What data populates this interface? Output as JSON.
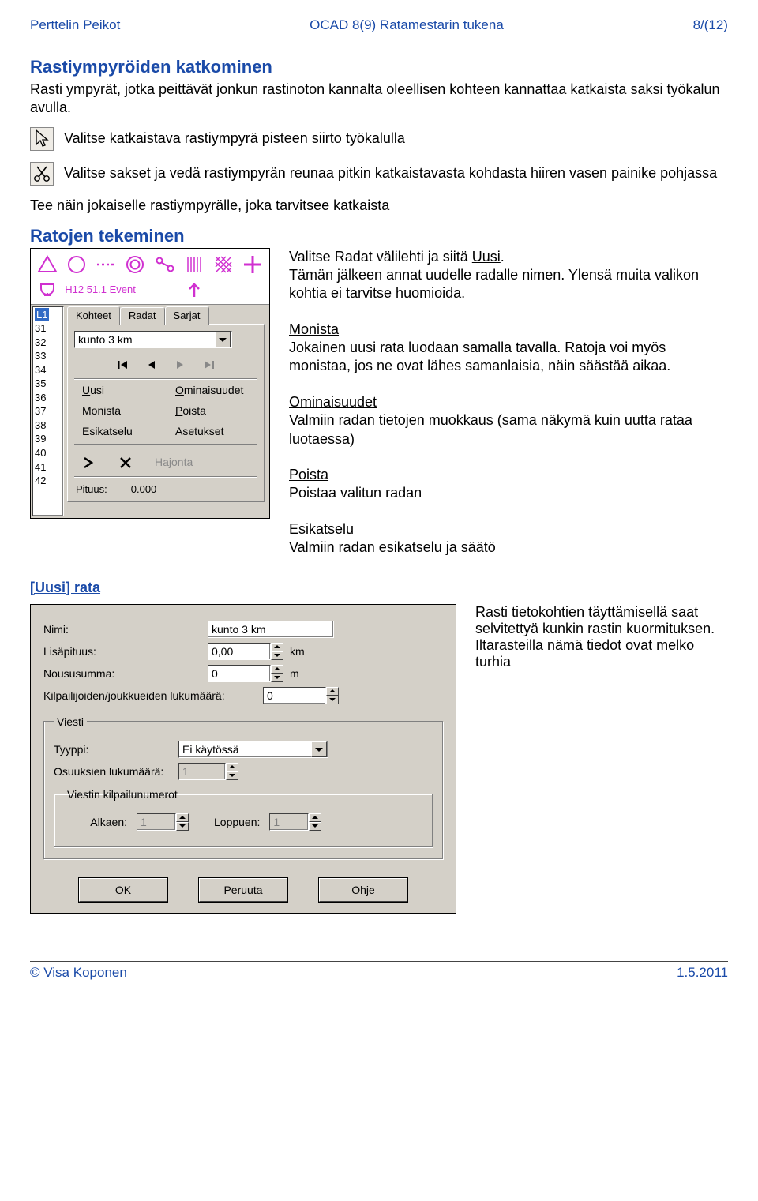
{
  "header": {
    "left": "Perttelin Peikot",
    "center": "OCAD 8(9) Ratamestarin tukena",
    "right": "8/(12)"
  },
  "section1": {
    "title": "Rastiympyröiden katkominen",
    "intro": "Rasti ympyrät, jotka peittävät jonkun rastinoton kannalta oleellisen kohteen kannattaa katkaista saksi työkalun avulla.",
    "p1": "Valitse katkaistava rastiympyrä pisteen siirto työkalulla",
    "p2": "Valitse sakset ja vedä rastiympyrän reunaa pitkin katkaistavasta kohdasta hiiren vasen painike pohjassa",
    "p3": "Tee näin jokaiselle rastiympyrälle, joka tarvitsee katkaista"
  },
  "section2": {
    "title": "Ratojen tekeminen",
    "panel": {
      "listbox": {
        "selected": "L1",
        "items": [
          "31",
          "32",
          "33",
          "34",
          "35",
          "36",
          "37",
          "38",
          "39",
          "40",
          "41",
          "42"
        ]
      },
      "tabs": [
        "Kohteet",
        "Radat",
        "Sarjat"
      ],
      "active_tab": 1,
      "combo": "kunto 3 km",
      "menu": {
        "uusi": "Uusi",
        "uusi_u": "U",
        "omin": "Ominaisuudet",
        "omin_u": "O",
        "monista": "Monista",
        "poista": "Poista",
        "poista_u": "P",
        "esi": "Esikatselu",
        "aset": "Asetukset",
        "hajonta": "Hajonta"
      },
      "length_label": "Pituus:",
      "length_value": "0.000",
      "row2_text": "H12 51.1 Event"
    },
    "desc": {
      "intro": "Valitse Radat välilehti ja siitä Uusi.\nTämän jälkeen annat uudelle radalle nimen. Ylensä muita valikon kohtia ei tarvitse huomioida.",
      "monista_t": "Monista",
      "monista": "Jokainen uusi rata luodaan samalla tavalla. Ratoja voi myös monistaa, jos ne ovat lähes samanlaisia, näin säästää aikaa.",
      "omin_t": "Ominaisuudet",
      "omin": "Valmiin radan tietojen muokkaus (sama näkymä kuin uutta rataa luotaessa)",
      "poista_t": "Poista",
      "poista": "Poistaa valitun radan",
      "esi_t": "Esikatselu",
      "esi": "Valmiin radan esikatselu ja säätö"
    }
  },
  "section3": {
    "title": "[Uusi] rata",
    "dialog": {
      "nimi_l": "Nimi:",
      "nimi_v": "kunto 3 km",
      "lisap_l": "Lisäpituus:",
      "lisap_v": "0,00",
      "lisap_u": "km",
      "nousu_l": "Noususumma:",
      "nousu_v": "0",
      "nousu_u": "m",
      "kilp_l": "Kilpailijoiden/joukkueiden lukumäärä:",
      "kilp_v": "0",
      "viesti": {
        "legend": "Viesti",
        "tyyppi_l": "Tyyppi:",
        "tyyppi_v": "Ei käytössä",
        "osuus_l": "Osuuksien lukumäärä:",
        "osuus_v": "1",
        "kilpnum": "Viestin kilpailunumerot",
        "alkaen_l": "Alkaen:",
        "alkaen_v": "1",
        "loppuen_l": "Loppuen:",
        "loppuen_v": "1"
      },
      "ok": "OK",
      "peruuta": "Peruuta",
      "ohje": "Ohje",
      "ohje_u": "O"
    },
    "note": "Rasti tietokohtien täyttämisellä saat selvitettyä kunkin rastin kuormituksen. Iltarasteilla nämä tiedot ovat melko turhia"
  },
  "footer": {
    "left": "© Visa Koponen",
    "right": "1.5.2011"
  }
}
